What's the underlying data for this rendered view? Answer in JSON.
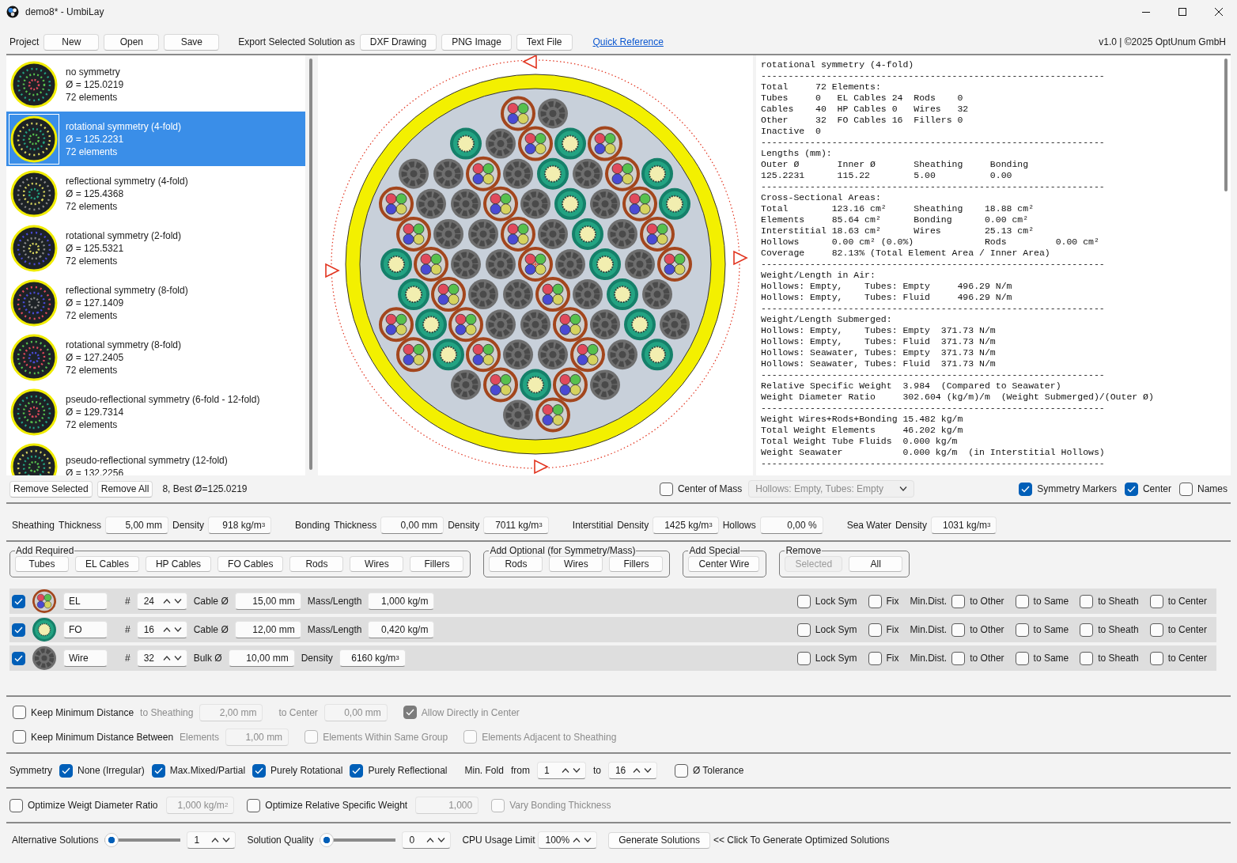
{
  "window": {
    "title": "demo8* - UmbiLay"
  },
  "toolbar": {
    "project_label": "Project",
    "project_buttons": [
      "New",
      "Open",
      "Save"
    ],
    "export_label": "Export Selected Solution as",
    "export_buttons": [
      "DXF Drawing",
      "PNG Image",
      "Text File"
    ],
    "link": "Quick Reference",
    "version": "v1.0 | ©2025 OptUnum GmbH"
  },
  "solutions": [
    {
      "name": "no symmetry",
      "diameter": "Ø = 125.0219",
      "elements": "72 elements",
      "selected": false
    },
    {
      "name": "rotational symmetry (4-fold)",
      "diameter": "Ø = 125.2231",
      "elements": "72 elements",
      "selected": true
    },
    {
      "name": "reflectional symmetry (4-fold)",
      "diameter": "Ø = 125.4368",
      "elements": "72 elements",
      "selected": false
    },
    {
      "name": "rotational symmetry (2-fold)",
      "diameter": "Ø = 125.5321",
      "elements": "72 elements",
      "selected": false
    },
    {
      "name": "reflectional symmetry (8-fold)",
      "diameter": "Ø = 127.1409",
      "elements": "72 elements",
      "selected": false
    },
    {
      "name": "rotational symmetry (8-fold)",
      "diameter": "Ø = 127.2405",
      "elements": "72 elements",
      "selected": false
    },
    {
      "name": "pseudo-reflectional symmetry (6-fold - 12-fold)",
      "diameter": "Ø = 129.7314",
      "elements": "72 elements",
      "selected": false
    },
    {
      "name": "pseudo-reflectional symmetry (12-fold)",
      "diameter": "Ø = 132.2256",
      "selected": false
    }
  ],
  "report": {
    "lines": [
      "rotational symmetry (4-fold)",
      "---------------------------------------------------------------",
      "Total     72 Elements:",
      "Tubes     0   EL Cables 24  Rods    0",
      "Cables    40  HP Cables 0   Wires   32",
      "Other     32  FO Cables 16  Fillers 0",
      "Inactive  0",
      "---------------------------------------------------------------",
      "Lengths (mm):",
      "Outer Ø       Inner Ø       Sheathing     Bonding",
      "125.2231      115.22        5.00          0.00",
      "---------------------------------------------------------------",
      "Cross-Sectional Areas:",
      "Total        123.16 cm²     Sheathing    18.88 cm²",
      "Elements     85.64 cm²      Bonding      0.00 cm²",
      "Interstitial 18.63 cm²      Wires        25.13 cm²",
      "Hollows      0.00 cm² (0.0%)             Rods         0.00 cm²",
      "Coverage     82.13% (Total Element Area / Inner Area)",
      "---------------------------------------------------------------",
      "Weight/Length in Air:",
      "Hollows: Empty,    Tubes: Empty     496.29 N/m",
      "Hollows: Empty,    Tubes: Fluid     496.29 N/m",
      "---------------------------------------------------------------",
      "Weight/Length Submerged:",
      "Hollows: Empty,    Tubes: Empty  371.73 N/m",
      "Hollows: Empty,    Tubes: Fluid  371.73 N/m",
      "Hollows: Seawater, Tubes: Empty  371.73 N/m",
      "Hollows: Seawater, Tubes: Fluid  371.73 N/m",
      "---------------------------------------------------------------",
      "Relative Specific Weight  3.984  (Compared to Seawater)",
      "Weight Diameter Ratio     302.604 (kg/m)/m  (Weight Submerged)/(Outer Ø)",
      "---------------------------------------------------------------",
      "Weight Wires+Rods+Bonding 15.482 kg/m",
      "Total Weight Elements     46.202 kg/m",
      "Total Weight Tube Fluids  0.000 kg/m",
      "Weight Seawater           0.000 kg/m  (in Interstitial Hollows)",
      "---------------------------------------------------------------"
    ]
  },
  "action_bar": {
    "buttons": [
      "Remove Selected",
      "Remove All"
    ],
    "summary": "8, Best Ø=125.0219",
    "center_of_mass": {
      "label": "Center of Mass",
      "checked": false
    },
    "weight_case": {
      "value": "Hollows: Empty, Tubes: Empty",
      "disabled": true
    },
    "symmetry_markers": {
      "label": "Symmetry Markers",
      "checked": true
    },
    "center": {
      "label": "Center",
      "checked": true
    },
    "names": {
      "label": "Names",
      "checked": false
    }
  },
  "materials": {
    "groups": [
      [
        {
          "kind": "label",
          "text": "Sheathing",
          "disabled": false
        },
        {
          "kind": "label",
          "text": "Thickness",
          "disabled": false
        },
        {
          "kind": "field",
          "value": "5,00 mm",
          "disabled": false
        },
        {
          "kind": "label",
          "text": "Density",
          "disabled": false
        },
        {
          "kind": "field",
          "value": "918 kg/m$^{3}$",
          "disabled": false
        }
      ],
      [
        {
          "kind": "label",
          "text": "Bonding",
          "disabled": false
        },
        {
          "kind": "label",
          "text": "Thickness",
          "disabled": false
        },
        {
          "kind": "field",
          "value": "0,00 mm",
          "disabled": false
        },
        {
          "kind": "label",
          "text": "Density",
          "disabled": false
        },
        {
          "kind": "field",
          "value": "7011 kg/m$^{3}$",
          "disabled": false
        }
      ],
      [
        {
          "kind": "label",
          "text": "Interstitial",
          "disabled": false
        },
        {
          "kind": "label",
          "text": "Density",
          "disabled": false
        },
        {
          "kind": "field",
          "value": "1425 kg/m$^{3}$",
          "disabled": false
        },
        {
          "kind": "label",
          "text": "Hollows",
          "disabled": false
        },
        {
          "kind": "field",
          "value": "0,00 %",
          "disabled": false
        }
      ],
      [
        {
          "kind": "label",
          "text": "Sea Water",
          "disabled": false
        },
        {
          "kind": "label",
          "text": "Density",
          "disabled": false
        },
        {
          "kind": "field",
          "value": "1031 kg/m$^{3}$",
          "disabled": false
        }
      ]
    ]
  },
  "add_groups": [
    {
      "title": "Add Required",
      "buttons": [
        {
          "label": "Tubes",
          "disabled": false
        },
        {
          "label": "EL Cables",
          "disabled": false
        },
        {
          "label": "HP Cables",
          "disabled": false
        },
        {
          "label": "FO Cables",
          "disabled": false
        },
        {
          "label": "Rods",
          "disabled": false
        },
        {
          "label": "Wires",
          "disabled": false
        },
        {
          "label": "Fillers",
          "disabled": false
        }
      ]
    },
    {
      "title": "Add Optional (for Symmetry/Mass)",
      "buttons": [
        {
          "label": "Rods",
          "disabled": false
        },
        {
          "label": "Wires",
          "disabled": false
        },
        {
          "label": "Fillers",
          "disabled": false
        }
      ]
    },
    {
      "title": "Add Special",
      "buttons": [
        {
          "label": "Center Wire",
          "disabled": false
        }
      ]
    },
    {
      "title": "Remove",
      "buttons": [
        {
          "label": "Selected",
          "disabled": true
        },
        {
          "label": "All",
          "disabled": false
        }
      ]
    }
  ],
  "elements": [
    {
      "kind": "el",
      "enabled": true,
      "name": "EL",
      "count_label": "#",
      "count": "24",
      "size_label": "Cable Ø",
      "size": "15,00 mm",
      "mass_label": "Mass/Length",
      "mass": "1,000 kg/m",
      "options": [
        {
          "label": "Lock Sym",
          "checked": false
        },
        {
          "label": "Fix",
          "checked": false
        }
      ],
      "min_dist_label": "Min.Dist.",
      "min_dist": [
        {
          "label": "to Other",
          "checked": false
        },
        {
          "label": "to Same",
          "checked": false
        },
        {
          "label": "to Sheath",
          "checked": false
        },
        {
          "label": "to Center",
          "checked": false
        }
      ]
    },
    {
      "kind": "fo",
      "enabled": true,
      "name": "FO",
      "count_label": "#",
      "count": "16",
      "size_label": "Cable Ø",
      "size": "12,00 mm",
      "mass_label": "Mass/Length",
      "mass": "0,420 kg/m",
      "options": [
        {
          "label": "Lock Sym",
          "checked": false
        },
        {
          "label": "Fix",
          "checked": false
        }
      ],
      "min_dist_label": "Min.Dist.",
      "min_dist": [
        {
          "label": "to Other",
          "checked": false
        },
        {
          "label": "to Same",
          "checked": false
        },
        {
          "label": "to Sheath",
          "checked": false
        },
        {
          "label": "to Center",
          "checked": false
        }
      ]
    },
    {
      "kind": "wire",
      "enabled": true,
      "name": "Wire",
      "count_label": "#",
      "count": "32",
      "size_label": "Bulk Ø",
      "size": "10,00 mm",
      "mass_label": "Density",
      "mass": "6160 kg/m$^{3}$",
      "options": [
        {
          "label": "Lock Sym",
          "checked": false
        },
        {
          "label": "Fix",
          "checked": false
        }
      ],
      "min_dist_label": "Min.Dist.",
      "min_dist": [
        {
          "label": "to Other",
          "checked": false
        },
        {
          "label": "to Same",
          "checked": false
        },
        {
          "label": "to Sheath",
          "checked": false
        },
        {
          "label": "to Center",
          "checked": false
        }
      ]
    }
  ],
  "distance_rows": [
    {
      "groups": [
        [
          {
            "kind": "checkbox",
            "text": "Keep Minimum Distance",
            "checked": false,
            "disabled": false
          },
          {
            "kind": "label",
            "text": "to Sheathing",
            "disabled": true
          },
          {
            "kind": "field",
            "value": "2,00 mm",
            "disabled": true
          }
        ],
        [
          {
            "kind": "label",
            "text": "to Center",
            "disabled": true
          },
          {
            "kind": "field",
            "value": "0,00 mm",
            "disabled": true
          }
        ],
        [
          {
            "kind": "checkbox",
            "text": "Allow Directly in Center",
            "checked": true,
            "disabled": true
          }
        ]
      ]
    },
    {
      "groups": [
        [
          {
            "kind": "checkbox",
            "text": "Keep Minimum Distance Between",
            "checked": false,
            "disabled": false
          },
          {
            "kind": "label",
            "text": "Elements",
            "disabled": true
          },
          {
            "kind": "field",
            "value": "1,00 mm",
            "disabled": true
          }
        ],
        [
          {
            "kind": "checkbox",
            "text": "Elements Within Same Group",
            "checked": false,
            "disabled": true
          }
        ],
        [
          {
            "kind": "checkbox",
            "text": "Elements Adjacent to Sheathing",
            "checked": false,
            "disabled": true
          }
        ]
      ]
    }
  ],
  "symmetry_row": {
    "groups": [
      [
        {
          "kind": "label",
          "text": "Symmetry",
          "disabled": false
        },
        {
          "kind": "checkbox",
          "text": "None (Irregular)",
          "checked": true,
          "disabled": false
        },
        {
          "kind": "checkbox",
          "text": "Max.Mixed/Partial",
          "checked": true,
          "disabled": false
        },
        {
          "kind": "checkbox",
          "text": "Purely Rotational",
          "checked": true,
          "disabled": false
        },
        {
          "kind": "checkbox",
          "text": "Purely Reflectional",
          "checked": true,
          "disabled": false
        }
      ],
      [
        {
          "kind": "label",
          "text": "Min. Fold",
          "disabled": false
        },
        {
          "kind": "label",
          "text": "from",
          "disabled": false
        },
        {
          "kind": "spinner",
          "value": "1"
        },
        {
          "kind": "label",
          "text": "to",
          "disabled": false
        },
        {
          "kind": "spinner",
          "value": "16"
        }
      ],
      [
        {
          "kind": "checkbox",
          "text": "Ø Tolerance",
          "checked": false,
          "disabled": false
        }
      ]
    ]
  },
  "optimize_row": {
    "groups": [
      [
        {
          "kind": "checkbox",
          "text": "Optimize Weigt Diameter Ratio",
          "checked": false,
          "disabled": false
        },
        {
          "kind": "field",
          "value": "1,000 kg/m$^{2}$",
          "disabled": true
        }
      ],
      [
        {
          "kind": "checkbox",
          "text": "Optimize Relative Specific Weight",
          "checked": false,
          "disabled": false
        },
        {
          "kind": "field",
          "value": "1,000",
          "disabled": true
        }
      ],
      [
        {
          "kind": "checkbox",
          "text": "Vary Bonding Thickness",
          "checked": false,
          "disabled": true
        }
      ]
    ]
  },
  "solve_row": {
    "groups": [
      [
        {
          "kind": "label",
          "text": "Alternative Solutions",
          "disabled": false
        },
        {
          "kind": "slider",
          "level": 0
        },
        {
          "kind": "spinner",
          "value": "1"
        }
      ],
      [
        {
          "kind": "label",
          "text": "Solution Quality",
          "disabled": false
        },
        {
          "kind": "slider",
          "level": 0
        },
        {
          "kind": "spinner",
          "value": "0"
        }
      ],
      [
        {
          "kind": "label",
          "text": "CPU Usage Limit",
          "disabled": false
        },
        {
          "kind": "spinner",
          "value": "100%"
        }
      ],
      [
        {
          "kind": "button",
          "text": "Generate Solutions",
          "disabled": false
        },
        {
          "kind": "label",
          "text": "<< Click To Generate Optimized Solutions",
          "disabled": false
        }
      ]
    ]
  }
}
